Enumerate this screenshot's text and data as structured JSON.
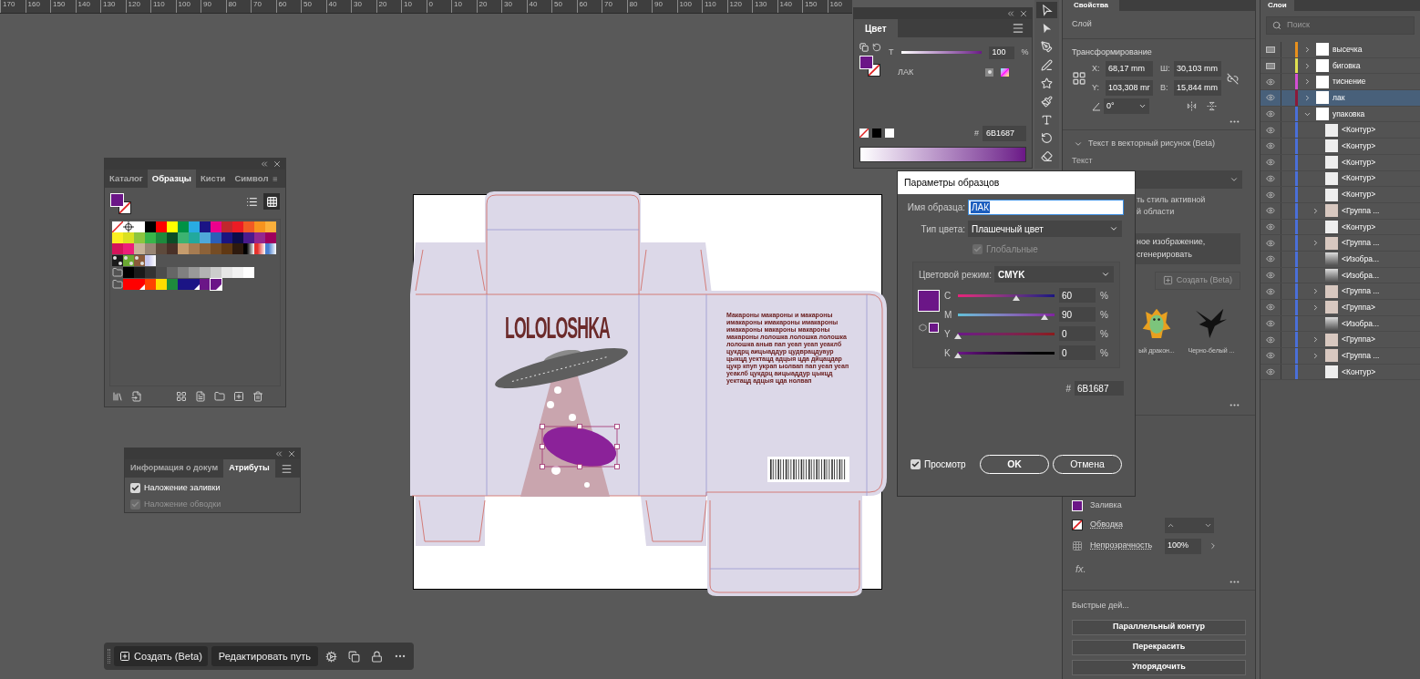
{
  "ruler": {
    "labels": [
      "170",
      "160",
      "150",
      "140",
      "130",
      "120",
      "110",
      "100",
      "90",
      "80",
      "70",
      "60",
      "50",
      "40",
      "30",
      "20",
      "10",
      "0",
      "10",
      "20",
      "30",
      "40",
      "50",
      "60",
      "70",
      "80",
      "90",
      "100",
      "110",
      "120",
      "130",
      "140",
      "150",
      "160"
    ]
  },
  "color_panel": {
    "tab": "Цвет",
    "tint_label": "T",
    "tint": {
      "level": 1
    },
    "tint_value": "100",
    "percent": "%",
    "swatch_name": "ЛАК",
    "hash": "#",
    "hex": "6B1687"
  },
  "tools": [
    {
      "kind": "selection",
      "selected": true
    },
    {
      "kind": "direct",
      "selected": false
    },
    {
      "kind": "pen",
      "selected": false
    },
    {
      "kind": "curvature",
      "selected": false
    },
    {
      "kind": "star",
      "selected": false
    },
    {
      "kind": "brush",
      "selected": false
    },
    {
      "kind": "type",
      "selected": false
    },
    {
      "kind": "rotate",
      "selected": false
    },
    {
      "kind": "eraser",
      "selected": false
    }
  ],
  "swatches_panel": {
    "tabs": [
      {
        "label": "Каталог",
        "selected": false
      },
      {
        "label": "Образцы",
        "selected": true
      },
      {
        "label": "Кисти",
        "selected": false
      },
      {
        "label": "Символ",
        "selected": false
      }
    ],
    "views": [
      {
        "kind": "list",
        "selected": false
      },
      {
        "kind": "grid",
        "selected": true
      }
    ],
    "rows": [
      [
        {
          "kind": "none",
          "selected": false
        },
        {
          "kind": "registration",
          "selected": false
        },
        {
          "kind": "solid",
          "color": "#ffffff",
          "selected": false
        },
        {
          "kind": "solid",
          "color": "#000000",
          "selected": false
        },
        {
          "kind": "solid",
          "color": "#ff0000",
          "selected": false
        },
        {
          "kind": "solid",
          "color": "#ffff00",
          "selected": false
        },
        {
          "kind": "solid",
          "color": "#009245",
          "selected": false
        },
        {
          "kind": "solid",
          "color": "#29abe2",
          "selected": false
        },
        {
          "kind": "solid",
          "color": "#1b1485",
          "selected": false
        },
        {
          "kind": "solid",
          "color": "#ec008c",
          "selected": false
        },
        {
          "kind": "solid",
          "color": "#c1272d",
          "selected": false
        },
        {
          "kind": "solid",
          "color": "#ed1c24",
          "selected": false
        },
        {
          "kind": "solid",
          "color": "#f15a24",
          "selected": false
        },
        {
          "kind": "solid",
          "color": "#f7931e",
          "selected": false
        },
        {
          "kind": "solid",
          "color": "#fbb03b",
          "selected": false
        }
      ],
      [
        {
          "kind": "solid",
          "color": "#fcee21",
          "selected": false
        },
        {
          "kind": "solid",
          "color": "#d9e021",
          "selected": false
        },
        {
          "kind": "solid",
          "color": "#8cc63f",
          "selected": false
        },
        {
          "kind": "solid",
          "color": "#39b54a",
          "selected": false
        },
        {
          "kind": "solid",
          "color": "#1e8a3c",
          "selected": false
        },
        {
          "kind": "solid",
          "color": "#0b4d26",
          "selected": false
        },
        {
          "kind": "solid",
          "color": "#3cb371",
          "selected": false
        },
        {
          "kind": "solid",
          "color": "#22a99d",
          "selected": false
        },
        {
          "kind": "solid",
          "color": "#4fa8d8",
          "selected": false
        },
        {
          "kind": "solid",
          "color": "#2b5fb8",
          "selected": false
        },
        {
          "kind": "solid",
          "color": "#1b1480",
          "selected": false
        },
        {
          "kind": "solid",
          "color": "#0c0c4a",
          "selected": false
        },
        {
          "kind": "solid",
          "color": "#4b1a8c",
          "selected": false
        },
        {
          "kind": "solid",
          "color": "#93278f",
          "selected": false
        },
        {
          "kind": "solid",
          "color": "#9e005d",
          "selected": false
        }
      ],
      [
        {
          "kind": "solid",
          "color": "#d4145a",
          "selected": false
        },
        {
          "kind": "solid",
          "color": "#ed1e79",
          "selected": false
        },
        {
          "kind": "solid",
          "color": "#c7b299",
          "selected": false
        },
        {
          "kind": "solid",
          "color": "#998675",
          "selected": false
        },
        {
          "kind": "solid",
          "color": "#5e4a3c",
          "selected": false
        },
        {
          "kind": "solid",
          "color": "#4a3128",
          "selected": false
        },
        {
          "kind": "solid",
          "color": "#c69c6d",
          "selected": false
        },
        {
          "kind": "solid",
          "color": "#a67c52",
          "selected": false
        },
        {
          "kind": "solid",
          "color": "#8c6239",
          "selected": false
        },
        {
          "kind": "solid",
          "color": "#754c24",
          "selected": false
        },
        {
          "kind": "solid",
          "color": "#603813",
          "selected": false
        },
        {
          "kind": "solid",
          "color": "#2e1a0e",
          "selected": false
        },
        {
          "kind": "gradient",
          "color": "#000000",
          "selected": false
        },
        {
          "kind": "gradient",
          "color": "#e5322d",
          "selected": false
        },
        {
          "kind": "gradient",
          "color": "#4a7fd0",
          "selected": false
        }
      ],
      [
        {
          "kind": "pattern",
          "color": "#1a1a1a",
          "selected": false
        },
        {
          "kind": "pattern",
          "color": "#6aa832",
          "selected": false
        },
        {
          "kind": "pattern",
          "color": "#8a5a3a",
          "selected": false
        },
        {
          "kind": "gradient",
          "color": "#c8c8f0",
          "selected": false
        }
      ],
      [
        {
          "kind": "folder",
          "selected": false
        },
        {
          "kind": "solid",
          "color": "#000000",
          "selected": false
        },
        {
          "kind": "solid",
          "color": "#1a1a1a",
          "selected": false
        },
        {
          "kind": "solid",
          "color": "#333333",
          "selected": false
        },
        {
          "kind": "solid",
          "color": "#4d4d4d",
          "selected": false
        },
        {
          "kind": "solid",
          "color": "#666666",
          "selected": false
        },
        {
          "kind": "solid",
          "color": "#808080",
          "selected": false
        },
        {
          "kind": "solid",
          "color": "#999999",
          "selected": false
        },
        {
          "kind": "solid",
          "color": "#b3b3b3",
          "selected": false
        },
        {
          "kind": "solid",
          "color": "#cccccc",
          "selected": false
        },
        {
          "kind": "solid",
          "color": "#e6e6e6",
          "selected": false
        },
        {
          "kind": "solid",
          "color": "#f2f2f2",
          "selected": false
        },
        {
          "kind": "spot",
          "color": "#ffffff",
          "selected": false
        }
      ],
      [
        {
          "kind": "folder",
          "selected": false
        },
        {
          "kind": "solid",
          "color": "#ff0000",
          "selected": false
        },
        {
          "kind": "spot",
          "color": "#ff0000",
          "selected": false
        },
        {
          "kind": "solid",
          "color": "#ff4000",
          "selected": false
        },
        {
          "kind": "solid",
          "color": "#ffdd00",
          "selected": false
        },
        {
          "kind": "solid",
          "color": "#1e8a3c",
          "selected": false
        },
        {
          "kind": "solid",
          "color": "#1b1485",
          "selected": false
        },
        {
          "kind": "spot",
          "color": "#1b1485",
          "selected": false
        },
        {
          "kind": "solid",
          "color": "#6b1687",
          "selected": false
        },
        {
          "kind": "spot",
          "color": "#6b1687",
          "selected": true
        }
      ]
    ]
  },
  "attributes_panel": {
    "tabs": [
      {
        "label": "Информация о докум",
        "selected": false
      },
      {
        "label": "Атрибуты",
        "selected": true
      }
    ],
    "options": [
      {
        "label": "Наложение заливки",
        "checked": true,
        "disabled": false
      },
      {
        "label": "Наложение обводки",
        "checked": true,
        "disabled": true
      }
    ]
  },
  "artboard": {
    "logo": "LOLOLOSHKA",
    "body_text": "Макароны макароны и макароны имакароны имакароны имакароны имакароны макароны макароны макароны лолошка лолошка лолошка лолошка аныв пап уеап уеап уеаклб цукдрц аицыаддур цудврацдуаур цыкцд уектацд адцыя цда дйцацдар цукр кпуп украп ыолвап пап уеап уеап уеаклб цукдрц аицыаддур цыкцд уектацд адцыя цда нолвап"
  },
  "bottom_bar": {
    "buttons": [
      "Создать (Beta)",
      "Редактировать путь"
    ]
  },
  "dialog": {
    "title": "Параметры образцов",
    "name_label": "Имя образца:",
    "name_value": "ЛАК",
    "type_label": "Тип цвета:",
    "type_value": "Плашечный цвет",
    "global": {
      "label": "Глобальные",
      "checked": true,
      "disabled": true
    },
    "mode_label": "Цветовой режим:",
    "mode_value": "CMYK",
    "channels": [
      {
        "name": "C",
        "level": 0.6,
        "value": "60",
        "unit": "%"
      },
      {
        "name": "M",
        "level": 0.9,
        "value": "90",
        "unit": "%"
      },
      {
        "name": "Y",
        "level": 0,
        "value": "0",
        "unit": "%"
      },
      {
        "name": "K",
        "level": 0,
        "value": "0",
        "unit": "%"
      }
    ],
    "hash": "#",
    "hex": "6B1687",
    "preview": {
      "label": "Просмотр",
      "checked": true
    },
    "ok": "OK",
    "cancel": "Отмена"
  },
  "properties": {
    "tab": "Свойства",
    "section": "Слой",
    "transform_title": "Трансформирование",
    "fields": [
      {
        "label": "X:",
        "value": "68,17 mm"
      },
      {
        "label": "Ш:",
        "value": "30,103 mm"
      },
      {
        "label": "Y:",
        "value": "103,308 mr"
      },
      {
        "label": "В:",
        "value": "15,844 mm"
      }
    ],
    "angle_value": "0°",
    "text_to_vector": {
      "title": "Текст в векторный рисунок (Beta)",
      "expanded": true,
      "text_label": "Текст",
      "fragment_1": "ть стиль активной",
      "fragment_2": "й области",
      "prompt_1": "ное изображение,",
      "prompt_2": "сгенерировать",
      "create_button": "Создать (Beta)",
      "create_disabled": true,
      "samples": [
        "ый дракон...",
        "Черно-белый ..."
      ]
    },
    "appearance": {
      "fill_label": "Заливка",
      "stroke_label": "Обводка",
      "opacity_label": "Непрозрачность",
      "opacity_value": "100%",
      "fx": "fx."
    },
    "quick_title": "Быстрые дей...",
    "quick_buttons": [
      "Параллельный контур",
      "Перекрасить",
      "Упорядочить"
    ]
  },
  "layers": {
    "tab": "Слои",
    "search_placeholder": "Поиск",
    "items": [
      {
        "name": "высечка",
        "color": "#e8901c",
        "kind": "template",
        "expanded": false,
        "selected": false
      },
      {
        "name": "биговка",
        "color": "#e0e050",
        "kind": "template",
        "expanded": false,
        "selected": false
      },
      {
        "name": "тиснение",
        "color": "#d34fd3",
        "kind": "layer",
        "expanded": false,
        "selected": false
      },
      {
        "name": "лак",
        "color": "#8b1a3a",
        "kind": "layer",
        "expanded": false,
        "selected": true
      },
      {
        "name": "упаковка",
        "color": "#4a6fd8",
        "kind": "layer",
        "expanded": true,
        "selected": false,
        "children": [
          {
            "name": "<Контур>",
            "kind": "path"
          },
          {
            "name": "<Контур>",
            "kind": "path"
          },
          {
            "name": "<Контур>",
            "kind": "path"
          },
          {
            "name": "<Контур>",
            "kind": "path"
          },
          {
            "name": "<Контур>",
            "kind": "path"
          },
          {
            "name": "<Группа ...",
            "kind": "group"
          },
          {
            "name": "<Контур>",
            "kind": "path"
          },
          {
            "name": "<Группа ...",
            "kind": "group"
          },
          {
            "name": "<Изобра...",
            "kind": "image"
          },
          {
            "name": "<Изобра...",
            "kind": "image"
          },
          {
            "name": "<Группа ...",
            "kind": "group"
          },
          {
            "name": "<Группа>",
            "kind": "group"
          },
          {
            "name": "<Изобра...",
            "kind": "image"
          },
          {
            "name": "<Группа>",
            "kind": "group"
          },
          {
            "name": "<Группа ...",
            "kind": "group"
          },
          {
            "name": "<Контур>",
            "kind": "path"
          }
        ]
      }
    ]
  }
}
